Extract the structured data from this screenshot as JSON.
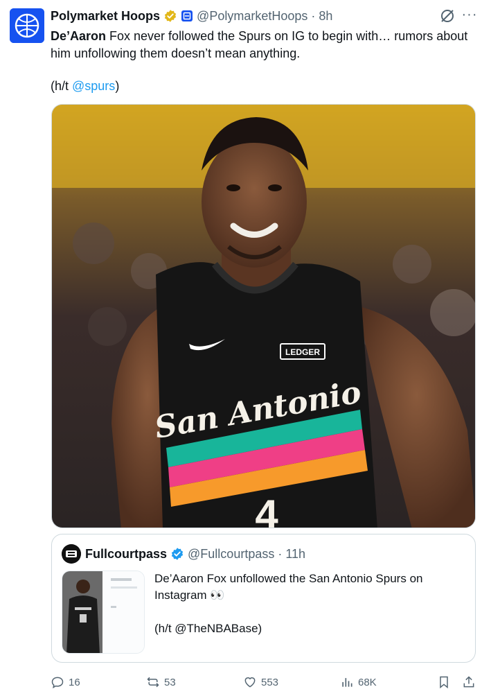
{
  "post": {
    "display_name": "Polymarket Hoops",
    "handle": "@PolymarketHoops",
    "separator": "·",
    "time": "8h",
    "text_bold": "De’Aaron",
    "text_rest": " Fox never followed the Spurs on IG to begin with… rumors about him unfollowing them doesn’t mean anything.",
    "ht_open": "(h/t ",
    "ht_link": "@spurs",
    "ht_close": ")",
    "more_label": "···"
  },
  "media": {
    "jersey_text": "San Antonio",
    "sponsor_text": "LEDGER",
    "number": "4"
  },
  "quote": {
    "display_name": "Fullcourtpass",
    "handle": "@Fullcourtpass",
    "separator": "·",
    "time": "11h",
    "text": "De’Aaron Fox unfollowed the San Antonio Spurs on Instagram 👀",
    "ht": "(h/t @TheNBABase)"
  },
  "actions": {
    "replies": "16",
    "reposts": "53",
    "likes": "553",
    "views": "68K"
  },
  "colors": {
    "accent": "#1d9bf0",
    "muted": "#536471",
    "verified_gold": "#e2b719",
    "brand_blue": "#1652f0"
  }
}
